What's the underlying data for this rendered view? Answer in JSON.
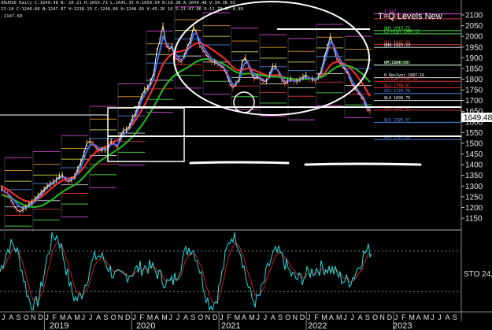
{
  "window": {
    "header_line1": "XAUUSD Daily C:1649.48 N: 10.21 H:1659.73 L:1641.35 O:1650.54 R:18.38 A:1649.48 V:34.1K OI",
    "header_line2": "13-18 C:1240.66 N:1247.87 H:1238.19 C:1248.66 H:1248.66 V:45.2K 16 S:21:47.66 R:11.78 N:-0.89",
    "header_line3": "2147.68"
  },
  "annotations": {
    "title": "T=Q Levels New",
    "price_tag": "1649.48",
    "stoch_label": "STO 24,"
  },
  "levels": [
    {
      "label": "1 222",
      "price": 2105,
      "color": "#ff55ff"
    },
    {
      "label": "R5 1999.09",
      "price": 2082,
      "color": "#ff4040"
    },
    {
      "label": "QH5 2016.75",
      "price": 2027,
      "color": "#55ff55"
    },
    {
      "label": "L3 High 1986.22",
      "price": 2012,
      "color": "#55ff55"
    },
    {
      "label": "QR1 1941.38",
      "price": 1961,
      "color": "#ff4040"
    },
    {
      "label": "QH4 1923.53",
      "price": 1948,
      "color": "#ffffff"
    },
    {
      "label": "QH3 1895.36",
      "price": 1866,
      "color": "#55ff55"
    },
    {
      "label": "QP 1884.06",
      "price": 1866,
      "color": "#ffffff"
    },
    {
      "label": "0 Res2ver 1807.16",
      "price": 1807,
      "color": "#ffffff"
    },
    {
      "label": "L3 Low 1798.33",
      "price": 1790,
      "color": "#ff4040"
    },
    {
      "label": "QL1 1748.97",
      "price": 1760,
      "color": "#ff4040"
    },
    {
      "label": "QS1 1729.78",
      "price": 1733,
      "color": "#5599ff"
    },
    {
      "label": "QL4 1690.79",
      "price": 1700,
      "color": "#ffffff"
    },
    {
      "label": "QS2 1662.41",
      "price": 1655,
      "color": "#ff4040"
    },
    {
      "label": "QL5 1595.57",
      "price": 1598,
      "color": "#5599ff"
    },
    {
      "label": "QS3 1519.28",
      "price": 1518,
      "color": "#5599ff"
    }
  ],
  "chart_data": {
    "type": "line",
    "y_axis": {
      "ticks": [
        1150,
        1200,
        1250,
        1300,
        1350,
        1400,
        1450,
        1500,
        1550,
        1600,
        1650,
        1700,
        1750,
        1800,
        1850,
        1900,
        1950,
        2000,
        2050,
        2100
      ],
      "range": [
        1095,
        2170
      ]
    },
    "x_months": [
      "J",
      "A",
      "S",
      "O",
      "N",
      "D",
      "J",
      "F",
      "M",
      "A",
      "M",
      "J",
      "J",
      "A",
      "S",
      "O",
      "N",
      "D",
      "J",
      "F",
      "M",
      "A",
      "M",
      "J",
      "J",
      "A",
      "S",
      "O",
      "N",
      "D",
      "J",
      "F",
      "M",
      "A",
      "M",
      "J",
      "J",
      "A",
      "S",
      "O",
      "N",
      "D",
      "J",
      "F",
      "M",
      "A",
      "M",
      "J",
      "J",
      "A",
      "S",
      "O",
      "N",
      "D",
      "J",
      "F",
      "M",
      "A",
      "M",
      "J",
      "J",
      "A",
      "S"
    ],
    "x_years": [
      "2019",
      "2020",
      "2021",
      "2022",
      "2023"
    ],
    "series": [
      {
        "color": "#ffffff",
        "values": [
          1290,
          1275,
          1265,
          1240,
          1210,
          1190,
          1180,
          1190,
          1200,
          1215,
          1225,
          1240,
          1255,
          1270,
          1285,
          1300,
          1310,
          1320,
          1330,
          1345,
          1350,
          1330,
          1320,
          1330,
          1345,
          1380,
          1410,
          1450,
          1500,
          1510,
          1500,
          1480,
          1465,
          1470,
          1470,
          1480,
          1510,
          1500,
          1480,
          1530,
          1560,
          1565,
          1580,
          1620,
          1640,
          1680,
          1720,
          1750,
          1760,
          1790,
          1830,
          1930,
          1980,
          2050,
          1960,
          1940,
          1950,
          1900,
          1890,
          1880,
          1910,
          1950,
          1980,
          2040,
          2020,
          1960,
          1940,
          1920,
          1900,
          1880,
          1880,
          1870,
          1860,
          1850,
          1820,
          1780,
          1760,
          1780,
          1800,
          1880,
          1900,
          1870,
          1830,
          1800,
          1810,
          1800,
          1790,
          1790,
          1820,
          1860,
          1860,
          1830,
          1800,
          1780,
          1790,
          1800,
          1790,
          1790,
          1800,
          1810,
          1820,
          1800,
          1800,
          1790,
          1810,
          1840,
          1900,
          1950,
          2000,
          1950,
          1900,
          1880,
          1860,
          1840,
          1820,
          1780,
          1760,
          1740,
          1720,
          1700,
          1660,
          1649.48
        ]
      },
      {
        "color": "#ff3030",
        "values": [
          1300,
          1292,
          1284,
          1274,
          1263,
          1253,
          1243,
          1236,
          1230,
          1228,
          1229,
          1233,
          1240,
          1249,
          1260,
          1272,
          1285,
          1297,
          1308,
          1318,
          1327,
          1332,
          1336,
          1340,
          1346,
          1356,
          1370,
          1388,
          1410,
          1430,
          1447,
          1460,
          1470,
          1477,
          1483,
          1490,
          1500,
          1508,
          1515,
          1526,
          1540,
          1554,
          1570,
          1588,
          1608,
          1630,
          1655,
          1682,
          1709,
          1736,
          1765,
          1800,
          1835,
          1870,
          1890,
          1905,
          1918,
          1925,
          1928,
          1930,
          1935,
          1940,
          1948,
          1960,
          1968,
          1968,
          1964,
          1958,
          1950,
          1940,
          1930,
          1920,
          1910,
          1899,
          1886,
          1870,
          1856,
          1846,
          1840,
          1842,
          1848,
          1850,
          1848,
          1842,
          1836,
          1830,
          1824,
          1818,
          1816,
          1818,
          1820,
          1818,
          1814,
          1808,
          1804,
          1802,
          1800,
          1798,
          1798,
          1800,
          1802,
          1802,
          1802,
          1802,
          1806,
          1814,
          1828,
          1846,
          1866,
          1876,
          1880,
          1880,
          1876,
          1868,
          1858,
          1844,
          1828,
          1810,
          1790,
          1768,
          1744,
          1720
        ]
      },
      {
        "color": "#20c020",
        "values": [
          1260,
          1255,
          1250,
          1244,
          1237,
          1229,
          1221,
          1214,
          1208,
          1204,
          1202,
          1202,
          1204,
          1208,
          1214,
          1222,
          1231,
          1241,
          1252,
          1263,
          1273,
          1282,
          1290,
          1298,
          1306,
          1316,
          1328,
          1342,
          1358,
          1374,
          1389,
          1402,
          1414,
          1424,
          1433,
          1442,
          1452,
          1461,
          1470,
          1480,
          1491,
          1503,
          1516,
          1530,
          1546,
          1564,
          1583,
          1604,
          1626,
          1648,
          1672,
          1698,
          1725,
          1752,
          1774,
          1792,
          1807,
          1820,
          1830,
          1838,
          1846,
          1854,
          1863,
          1873,
          1882,
          1888,
          1892,
          1894,
          1894,
          1892,
          1888,
          1883,
          1877,
          1870,
          1862,
          1852,
          1842,
          1834,
          1828,
          1825,
          1825,
          1826,
          1826,
          1825,
          1823,
          1820,
          1817,
          1814,
          1812,
          1811,
          1811,
          1810,
          1808,
          1806,
          1804,
          1802,
          1801,
          1800,
          1800,
          1800,
          1801,
          1802,
          1802,
          1803,
          1805,
          1809,
          1816,
          1826,
          1838,
          1848,
          1856,
          1861,
          1864,
          1864,
          1862,
          1857,
          1850,
          1841,
          1830,
          1817,
          1802,
          1786
        ]
      },
      {
        "color": "#4070ff",
        "values": [
          1285,
          1275,
          1266,
          1252,
          1235,
          1218,
          1204,
          1197,
          1198,
          1206,
          1216,
          1229,
          1244,
          1260,
          1276,
          1292,
          1305,
          1316,
          1326,
          1337,
          1345,
          1340,
          1332,
          1331,
          1338,
          1362,
          1390,
          1425,
          1466,
          1490,
          1496,
          1490,
          1478,
          1474,
          1472,
          1476,
          1496,
          1498,
          1489,
          1512,
          1540,
          1555,
          1570,
          1602,
          1626,
          1660,
          1700,
          1732,
          1748,
          1774,
          1808,
          1878,
          1932,
          1998,
          1972,
          1952,
          1951,
          1920,
          1902,
          1890,
          1902,
          1932,
          1960,
          2010,
          2016,
          1982,
          1958,
          1936,
          1914,
          1894,
          1886,
          1876,
          1866,
          1856,
          1832,
          1798,
          1774,
          1778,
          1792,
          1846,
          1878,
          1872,
          1846,
          1818,
          1814,
          1806,
          1796,
          1792,
          1810,
          1842,
          1852,
          1838,
          1814,
          1792,
          1790,
          1796,
          1792,
          1790,
          1796,
          1804,
          1814,
          1806,
          1802,
          1794,
          1804,
          1828,
          1878,
          1926,
          1974,
          1960,
          1924,
          1896,
          1872,
          1850,
          1830,
          1796,
          1772,
          1750,
          1730,
          1710,
          1676,
          1658
        ]
      }
    ]
  },
  "stoch_data": {
    "levels": [
      75,
      25
    ],
    "range": [
      0,
      100
    ]
  }
}
